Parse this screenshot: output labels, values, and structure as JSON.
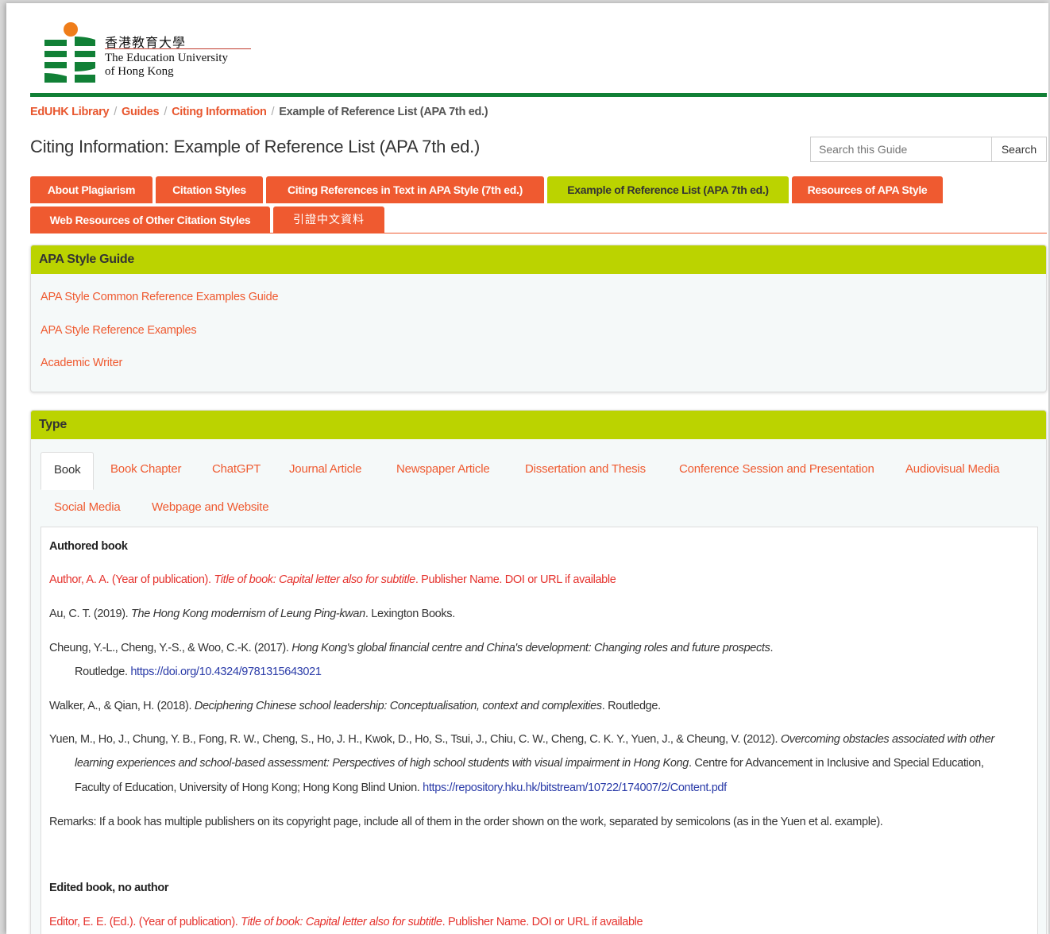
{
  "header": {
    "logo_cn": "香港教育大學",
    "logo_en_line1": "The Education University",
    "logo_en_line2": "of Hong Kong",
    "logo_colors": {
      "orange": "#ef7d1a",
      "green": "#118036"
    }
  },
  "breadcrumb": {
    "items": [
      "EdUHK Library",
      "Guides",
      "Citing Information"
    ],
    "current": "Example of Reference List (APA 7th ed.)",
    "separator": "/"
  },
  "page": {
    "title": "Citing Information: Example of Reference List (APA 7th ed.)"
  },
  "search": {
    "placeholder": "Search this Guide",
    "button_label": "Search"
  },
  "tabs": [
    {
      "label": "About Plagiarism"
    },
    {
      "label": "Citation Styles"
    },
    {
      "label": "Citing References in Text in APA Style (7th ed.)"
    },
    {
      "label": "Example of Reference List (APA 7th ed.)",
      "active": true
    },
    {
      "label": "Resources of APA Style"
    },
    {
      "label": "Web Resources of Other Citation Styles"
    },
    {
      "label": "引證中文資料"
    }
  ],
  "apa_guide_box": {
    "title": "APA Style Guide",
    "links": [
      "APA Style Common Reference Examples Guide",
      "APA Style Reference Examples",
      "Academic Writer"
    ]
  },
  "type_box": {
    "title": "Type",
    "subtabs": [
      {
        "label": "Book",
        "active": true
      },
      {
        "label": "Book Chapter"
      },
      {
        "label": "ChatGPT"
      },
      {
        "label": "Journal Article"
      },
      {
        "label": "Newspaper Article"
      },
      {
        "label": "Dissertation and Thesis"
      },
      {
        "label": "Conference Session and Presentation"
      },
      {
        "label": "Audiovisual Media"
      },
      {
        "label": "Social Media"
      },
      {
        "label": "Webpage and Website"
      }
    ],
    "content": {
      "authored_heading": "Authored book",
      "authored_template": {
        "pre": "Author, A. A. (Year of publication). ",
        "italic": "Title of book: Capital letter also for subtitle",
        "post": ". Publisher Name. DOI or URL if available"
      },
      "refs": {
        "r1_pre": "Au, C. T. (2019). ",
        "r1_italic": "The Hong Kong modernism of Leung Ping-kwan",
        "r1_post": ". Lexington Books.",
        "r2_pre": "Cheung, Y.-L., Cheng, Y.-S., & Woo, C.-K. (2017). ",
        "r2_italic": "Hong Kong's global financial centre and China's development: Changing roles and future prospects",
        "r2_post": ".",
        "r2_cont": "Routledge. ",
        "r2_doi": "https://doi.org/10.4324/9781315643021",
        "r3_pre": "Walker, A., & Qian, H. (2018). ",
        "r3_italic": "Deciphering Chinese school leadership: Conceptualisation, context and complexities",
        "r3_post": ". Routledge.",
        "r4_pre": "Yuen, M., Ho, J., Chung, Y. B., Fong, R. W., Cheng, S., Ho, J. H., Kwok, D., Ho, S., Tsui, J., Chiu, C. W., Cheng, C. K. Y., Yuen, J., & Cheung, V. (2012). ",
        "r4_italic1": "Overcoming obstacles associated with other",
        "r4_italic2": "learning experiences and school-based assessment: Perspectives of high school students with visual impairment in Hong Kong",
        "r4_post2": ". Centre for Advancement in Inclusive and Special Education,",
        "r4_line3": "Faculty of Education, University of Hong Kong; Hong Kong Blind Union. ",
        "r4_url": "https://repository.hku.hk/bitstream/10722/174007/2/Content.pdf"
      },
      "remarks": "Remarks: If a book has multiple publishers on its copyright page, include all of them in the order shown on the work, separated by semicolons (as in the Yuen et al. example).",
      "edited_heading": "Edited book, no author",
      "edited_template": {
        "pre": "Editor, E. E. (Ed.). (Year of publication). ",
        "italic": "Title of book: Capital letter also for subtitle",
        "post": ". Publisher Name. DOI or URL if available"
      }
    }
  },
  "colors": {
    "accent_orange": "#ef5a30",
    "accent_lime": "#bbd300",
    "brand_green": "#118036",
    "template_red": "#e5322d",
    "link_blue": "#2a3ba8"
  }
}
